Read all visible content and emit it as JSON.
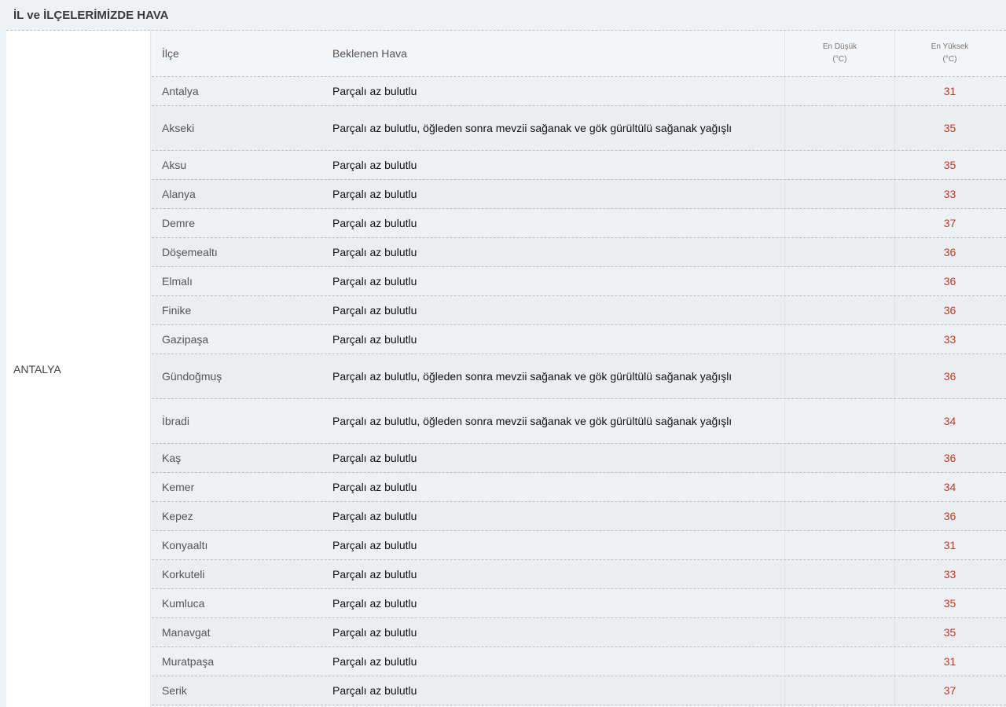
{
  "title": "İL ve İLÇELERİMİZDE HAVA",
  "province": "ANTALYA",
  "headers": {
    "district": "İlçe",
    "forecast": "Beklenen Hava",
    "low_line1": "En Düşük",
    "low_line2": "(°C)",
    "high_line1": "En Yüksek",
    "high_line2": "(°C)"
  },
  "rows": [
    {
      "district": "Antalya",
      "forecast": "Parçalı az bulutlu",
      "low": "",
      "high": "31"
    },
    {
      "district": "Akseki",
      "forecast": "Parçalı az bulutlu, öğleden sonra mevzii sağanak ve gök gürültülü sağanak yağışlı",
      "low": "",
      "high": "35"
    },
    {
      "district": "Aksu",
      "forecast": "Parçalı az bulutlu",
      "low": "",
      "high": "35"
    },
    {
      "district": "Alanya",
      "forecast": "Parçalı az bulutlu",
      "low": "",
      "high": "33"
    },
    {
      "district": "Demre",
      "forecast": "Parçalı az bulutlu",
      "low": "",
      "high": "37"
    },
    {
      "district": "Döşemealtı",
      "forecast": "Parçalı az bulutlu",
      "low": "",
      "high": "36"
    },
    {
      "district": "Elmalı",
      "forecast": "Parçalı az bulutlu",
      "low": "",
      "high": "36"
    },
    {
      "district": "Finike",
      "forecast": "Parçalı az bulutlu",
      "low": "",
      "high": "36"
    },
    {
      "district": "Gazipaşa",
      "forecast": "Parçalı az bulutlu",
      "low": "",
      "high": "33"
    },
    {
      "district": "Gündoğmuş",
      "forecast": "Parçalı az bulutlu, öğleden sonra mevzii sağanak ve gök gürültülü sağanak yağışlı",
      "low": "",
      "high": "36"
    },
    {
      "district": "İbradi",
      "forecast": "Parçalı az bulutlu, öğleden sonra mevzii sağanak ve gök gürültülü sağanak yağışlı",
      "low": "",
      "high": "34"
    },
    {
      "district": "Kaş",
      "forecast": "Parçalı az bulutlu",
      "low": "",
      "high": "36"
    },
    {
      "district": "Kemer",
      "forecast": "Parçalı az bulutlu",
      "low": "",
      "high": "34"
    },
    {
      "district": "Kepez",
      "forecast": "Parçalı az bulutlu",
      "low": "",
      "high": "36"
    },
    {
      "district": "Konyaaltı",
      "forecast": "Parçalı az bulutlu",
      "low": "",
      "high": "31"
    },
    {
      "district": "Korkuteli",
      "forecast": "Parçalı az bulutlu",
      "low": "",
      "high": "33"
    },
    {
      "district": "Kumluca",
      "forecast": "Parçalı az bulutlu",
      "low": "",
      "high": "35"
    },
    {
      "district": "Manavgat",
      "forecast": "Parçalı az bulutlu",
      "low": "",
      "high": "35"
    },
    {
      "district": "Muratpaşa",
      "forecast": "Parçalı az bulutlu",
      "low": "",
      "high": "31"
    },
    {
      "district": "Serik",
      "forecast": "Parçalı az bulutlu",
      "low": "",
      "high": "37"
    }
  ]
}
